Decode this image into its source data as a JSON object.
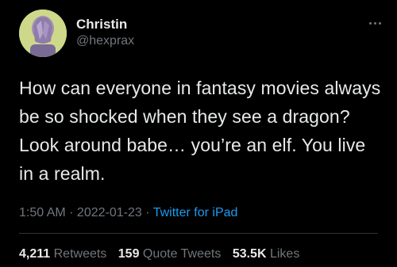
{
  "author": {
    "display_name": "Christin",
    "handle": "@hexprax",
    "avatar_icon": "praying-hands-avatar",
    "avatar_bg": "#cdd88a"
  },
  "menu": {
    "icon": "more-options-icon"
  },
  "tweet": {
    "text": "How can everyone in fantasy movies always be so shocked when they see a dragon? Look around babe… you’re an elf. You live in a realm."
  },
  "meta": {
    "time": "1:50 AM",
    "sep1": " · ",
    "date": "2022-01-23",
    "sep2": " · ",
    "source": "Twitter for iPad"
  },
  "stats": {
    "retweets": {
      "count": "4,211",
      "label": "Retweets"
    },
    "quotes": {
      "count": "159",
      "label": "Quote Tweets"
    },
    "likes": {
      "count": "53.5K",
      "label": "Likes"
    }
  },
  "colors": {
    "background": "#000000",
    "text": "#e7e9ea",
    "secondary": "#71767b",
    "link": "#1d9bf0",
    "divider": "#2f3336"
  }
}
